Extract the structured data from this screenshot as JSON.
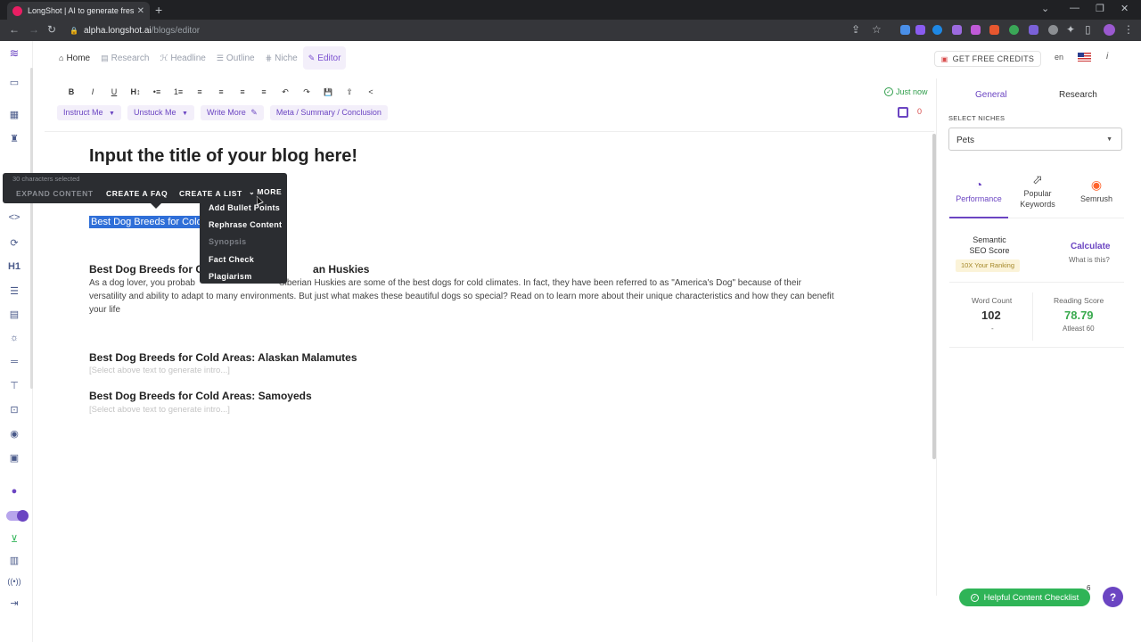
{
  "browser": {
    "tab_title": "LongShot | AI to generate fresh &",
    "url_host": "alpha.longshot.ai",
    "url_path": "/blogs/editor"
  },
  "topnav": {
    "items": [
      {
        "label": "Home",
        "icon": "home-icon"
      },
      {
        "label": "Research",
        "icon": "research-icon"
      },
      {
        "label": "Headline",
        "icon": "headline-icon"
      },
      {
        "label": "Outline",
        "icon": "outline-icon"
      },
      {
        "label": "Niche",
        "icon": "niche-icon"
      },
      {
        "label": "Editor",
        "icon": "editor-icon"
      }
    ],
    "credits_button": "GET FREE CREDITS",
    "language": "en"
  },
  "toolbar": {
    "buttons": [
      "B",
      "I",
      "U",
      "H↕",
      "•≡",
      "1≡",
      "≡",
      "≡",
      "≡",
      "≡",
      "↶",
      "↷",
      "💾",
      "⇧",
      "<"
    ],
    "saved_status": "Just now",
    "actions": [
      "Instruct Me",
      "Unstuck Me",
      "Write More",
      "Meta / Summary / Conclusion"
    ],
    "issue_count": "0"
  },
  "editor": {
    "title": "Input the title of your blog here!",
    "selected_text": "Best Dog Breeds for Cold .",
    "sections": [
      {
        "heading_visible_start": "Best Dog Breeds for C",
        "heading_visible_end": "an Huskies",
        "body_line1_start": "As a dog lover, you probab",
        "body_line1_end": "Siberian Huskies are some of the best dogs for cold climates. In fact, they have been referred to as \"America's Dog\" because of their",
        "body_line2": "versatility and ability to adapt to many environments. But just what makes these beautiful dogs so special? Read on to learn more about their unique characteristics and how they can benefit",
        "body_line3": "your life"
      },
      {
        "heading": "Best Dog Breeds for Cold Areas: Alaskan Malamutes",
        "placeholder": "[Select above text to generate intro...]"
      },
      {
        "heading": "Best Dog Breeds for Cold Areas: Samoyeds",
        "placeholder": "[Select above text to generate intro...]"
      }
    ]
  },
  "popup": {
    "selection_info": "30 characters selected",
    "buttons": [
      "EXPAND CONTENT",
      "CREATE A FAQ",
      "CREATE A LIST",
      "MORE"
    ],
    "more_menu": [
      "Add Bullet Points",
      "Rephrase Content",
      "Synopsis",
      "Fact Check",
      "Plagiarism"
    ]
  },
  "right_panel": {
    "tabs": [
      "General",
      "Research"
    ],
    "niche_label": "SELECT NICHES",
    "niche_value": "Pets",
    "metric_tabs": [
      {
        "label": "Performance",
        "icon": "speedometer-icon"
      },
      {
        "label": "Popular Keywords",
        "icon": "trend-icon"
      },
      {
        "label": "Semrush",
        "icon": "semrush-icon"
      }
    ],
    "seo_label": "Semantic SEO Score",
    "seo_badge": "10X Your Ranking",
    "calculate": "Calculate",
    "what_is_this": "What is this?",
    "word_count_label": "Word Count",
    "word_count": "102",
    "word_count_sub": "-",
    "reading_label": "Reading Score",
    "reading_score": "78.79",
    "reading_sub": "Atleast 60"
  },
  "footer": {
    "helpful_checklist": "Helpful Content Checklist",
    "helpful_count": "6",
    "help": "?"
  },
  "colors": {
    "accent": "#6b45c2",
    "selection": "#2f6fd8",
    "success": "#2fb457",
    "reading_score": "#3aaa4f"
  }
}
